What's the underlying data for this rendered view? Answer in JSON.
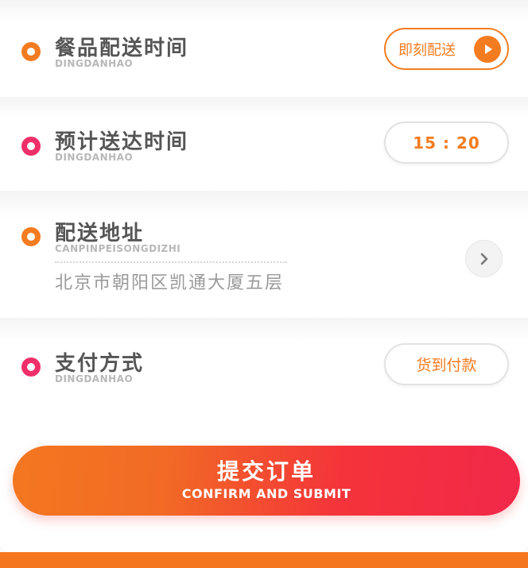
{
  "colors": {
    "accent_orange": "#f47c20",
    "accent_pink": "#ef2f6a",
    "submit_gradient_start": "#f47720",
    "submit_gradient_end": "#f2284a"
  },
  "delivery_time": {
    "title": "餐品配送时间",
    "subtitle": "DINGDANHAO",
    "button_label": "即刻配送",
    "button_icon": "play-icon"
  },
  "arrival_time": {
    "title": "预计送达时间",
    "subtitle": "DINGDANHAO",
    "value": "15 : 20"
  },
  "address": {
    "title": "配送地址",
    "subtitle": "CANPINPEISONGDIZHI",
    "value": "北京市朝阳区凯通大厦五层",
    "icon": "chevron-right-icon"
  },
  "payment": {
    "title": "支付方式",
    "subtitle": "DINGDANHAO",
    "value": "货到付款"
  },
  "submit": {
    "label_cn": "提交订单",
    "label_en": "CONFIRM AND SUBMIT"
  }
}
